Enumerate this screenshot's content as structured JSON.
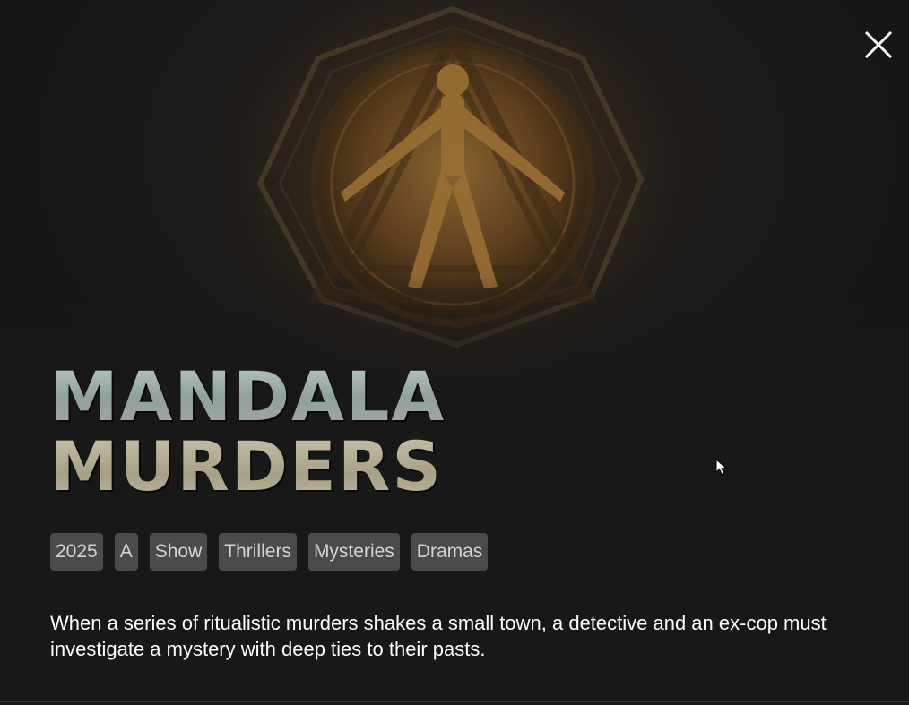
{
  "modal": {
    "close_icon": "close-icon",
    "hero_image": "mandala-artwork",
    "title_logo": {
      "line1": "MANDALA",
      "line2": "MURDERS"
    },
    "tags": [
      "2025",
      "A",
      "Show",
      "Thrillers",
      "Mysteries",
      "Dramas"
    ],
    "description": "When a series of ritualistic murders shakes a small town, a detective and an ex-cop must investigate a mystery with deep ties to their pasts.",
    "colors": {
      "background": "#181818",
      "tag_background": "#4a4a4a",
      "tag_text": "#d4d4d4",
      "description_text": "#ffffff"
    }
  }
}
